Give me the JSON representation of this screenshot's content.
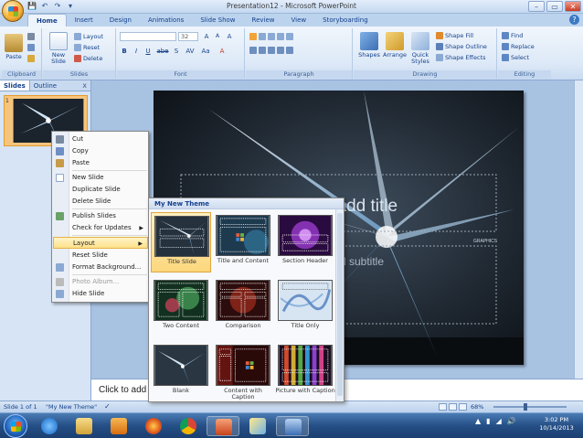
{
  "window": {
    "title": "Presentation12 - Microsoft PowerPoint",
    "qat": [
      "💾",
      "↶",
      "↷",
      "▾"
    ],
    "controls": [
      "–",
      "▭",
      "✕"
    ],
    "help": "?"
  },
  "tabs": [
    "Home",
    "Insert",
    "Design",
    "Animations",
    "Slide Show",
    "Review",
    "View",
    "Storyboarding"
  ],
  "ribbon": {
    "clipboard": {
      "label": "Clipboard",
      "paste": "Paste"
    },
    "slides": {
      "label": "Slides",
      "new_slide": "New Slide",
      "layout": "Layout",
      "reset": "Reset",
      "delete": "Delete"
    },
    "font": {
      "label": "Font",
      "font_name": "",
      "font_size": "32",
      "bold": "B",
      "italic": "I",
      "underline": "U",
      "strike": "abe",
      "shadow": "S",
      "spacing": "AV",
      "case": "Aa",
      "grow": "A",
      "shrink": "A",
      "clear": "A"
    },
    "paragraph": {
      "label": "Paragraph"
    },
    "drawing": {
      "label": "Drawing",
      "shapes": "Shapes",
      "arrange": "Arrange",
      "quick_styles": "Quick Styles",
      "shape_fill": "Shape Fill",
      "shape_outline": "Shape Outline",
      "shape_effects": "Shape Effects"
    },
    "editing": {
      "label": "Editing",
      "find": "Find",
      "replace": "Replace",
      "select": "Select"
    }
  },
  "left_panel": {
    "tab_slides": "Slides",
    "tab_outline": "Outline",
    "close": "x",
    "slide_number": "1"
  },
  "slide": {
    "title_placeholder": "Click to add title",
    "subtitle_placeholder": "Click to add subtitle",
    "brand": "GRAPHICS"
  },
  "notes": {
    "placeholder": "Click to add notes"
  },
  "context_menu": [
    {
      "label": "Cut",
      "icon": "scissors-icon",
      "color": "#7a8aa0"
    },
    {
      "label": "Copy",
      "icon": "copy-icon",
      "color": "#6e8fc4"
    },
    {
      "label": "Paste",
      "icon": "paste-icon",
      "color": "#c79b48"
    },
    {
      "label": "New Slide",
      "icon": "new-slide-icon",
      "color": "#ffffff"
    },
    {
      "label": "Duplicate Slide",
      "icon": "",
      "color": ""
    },
    {
      "label": "Delete Slide",
      "icon": "",
      "color": ""
    },
    {
      "label": "Publish Slides",
      "icon": "publish-icon",
      "color": "#6aa26a"
    },
    {
      "label": "Check for Updates",
      "icon": "",
      "color": "",
      "submenu": true
    },
    {
      "label": "Layout",
      "icon": "",
      "color": "",
      "submenu": true,
      "highlighted": true
    },
    {
      "label": "Reset Slide",
      "icon": "",
      "color": ""
    },
    {
      "label": "Format Background...",
      "icon": "background-icon",
      "color": "#8aa9d4"
    },
    {
      "label": "Photo Album...",
      "icon": "photo-album-icon",
      "color": "#bbbbbb",
      "disabled": true
    },
    {
      "label": "Hide Slide",
      "icon": "hide-slide-icon",
      "color": "#8aa9d4"
    }
  ],
  "gallery": {
    "header": "My New Theme",
    "layouts": [
      {
        "label": "Title Slide",
        "selected": true,
        "kind": "title"
      },
      {
        "label": "Title and Content",
        "kind": "content"
      },
      {
        "label": "Section Header",
        "kind": "section"
      },
      {
        "label": "Two Content",
        "kind": "two"
      },
      {
        "label": "Comparison",
        "kind": "comparison"
      },
      {
        "label": "Title Only",
        "kind": "titleonly"
      },
      {
        "label": "Blank",
        "kind": "blank"
      },
      {
        "label": "Content with Caption",
        "kind": "contentcaption"
      },
      {
        "label": "Picture with Caption",
        "kind": "picturecaption"
      }
    ]
  },
  "status": {
    "slide_info": "Slide 1 of 1",
    "theme": "\"My New Theme\"",
    "zoom": "68%"
  },
  "taskbar": {
    "time": "3:02 PM",
    "date": "10/14/2013",
    "tray": [
      "▲",
      "▮",
      "◢",
      "🔊"
    ]
  },
  "colors": {
    "accent": "#15428b",
    "ribbon_bg": "#dde9f7",
    "highlight": "#fde18a"
  }
}
